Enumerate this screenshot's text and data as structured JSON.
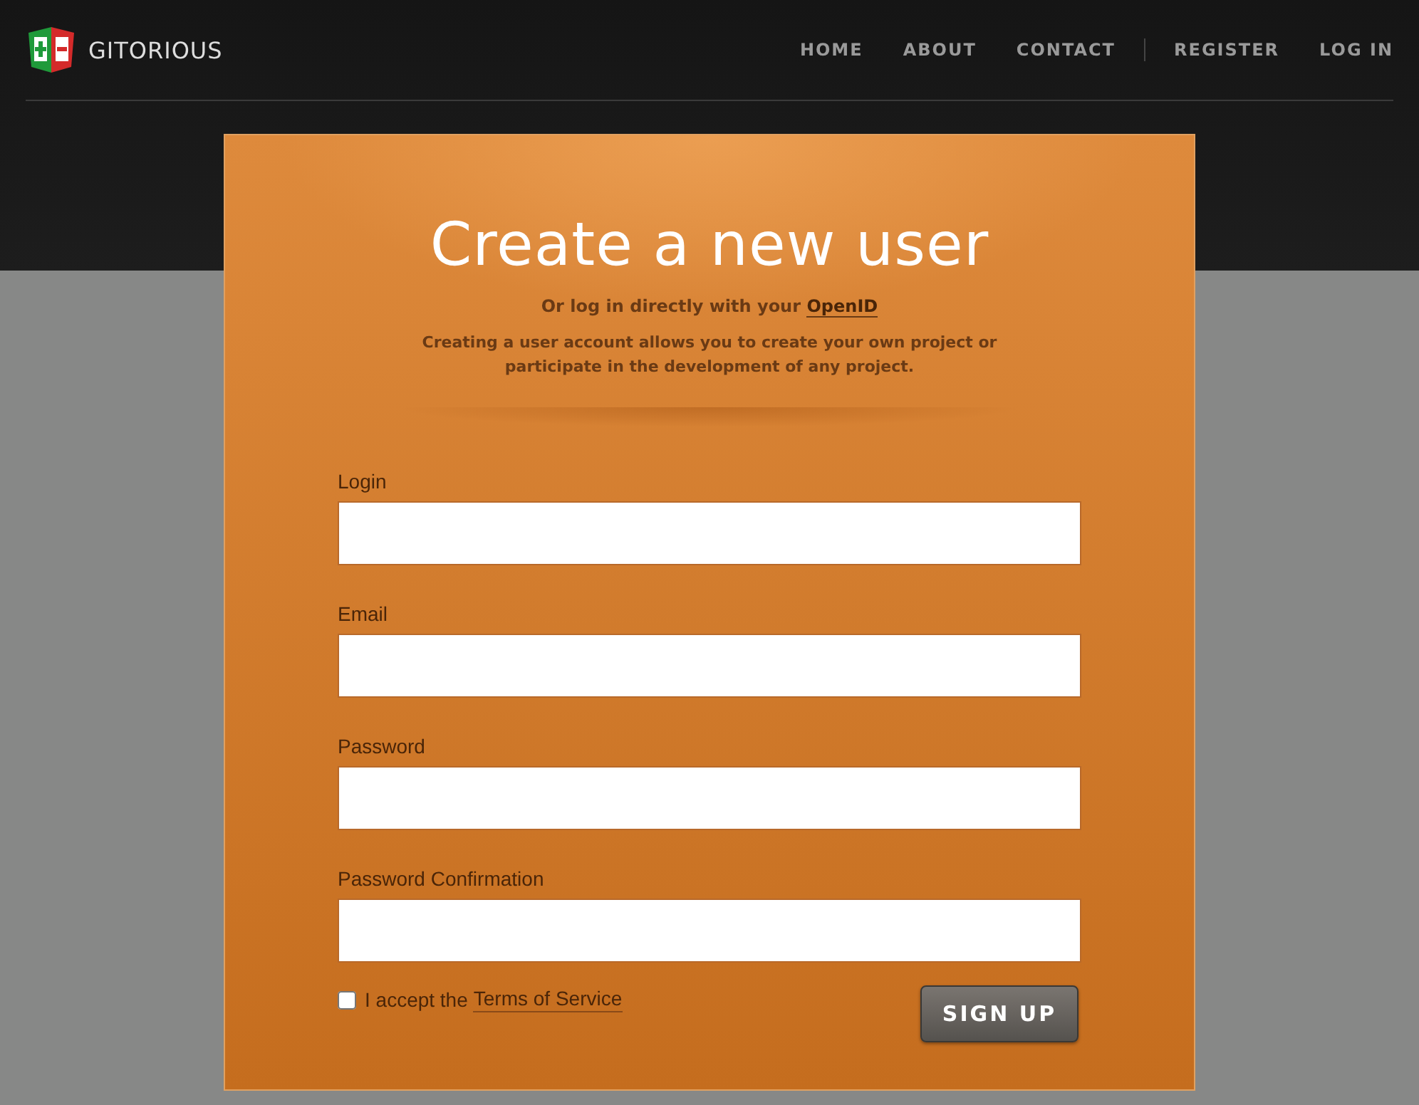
{
  "brand": {
    "name": "GITORIOUS"
  },
  "nav": {
    "main": [
      "HOME",
      "ABOUT",
      "CONTACT"
    ],
    "account": [
      "REGISTER",
      "LOG IN"
    ]
  },
  "form": {
    "title": "Create a new user",
    "openid": {
      "text": "Or log in directly with your",
      "link": "OpenID"
    },
    "intro": "Creating a user account allows you to create your own project or participate in the development of any project.",
    "fields": [
      {
        "label": "Login"
      },
      {
        "label": "Email"
      },
      {
        "label": "Password"
      },
      {
        "label": "Password Confirmation"
      }
    ],
    "terms": {
      "text": "I accept the",
      "link": "Terms of Service",
      "checked": false
    },
    "submit": "SIGN UP"
  }
}
